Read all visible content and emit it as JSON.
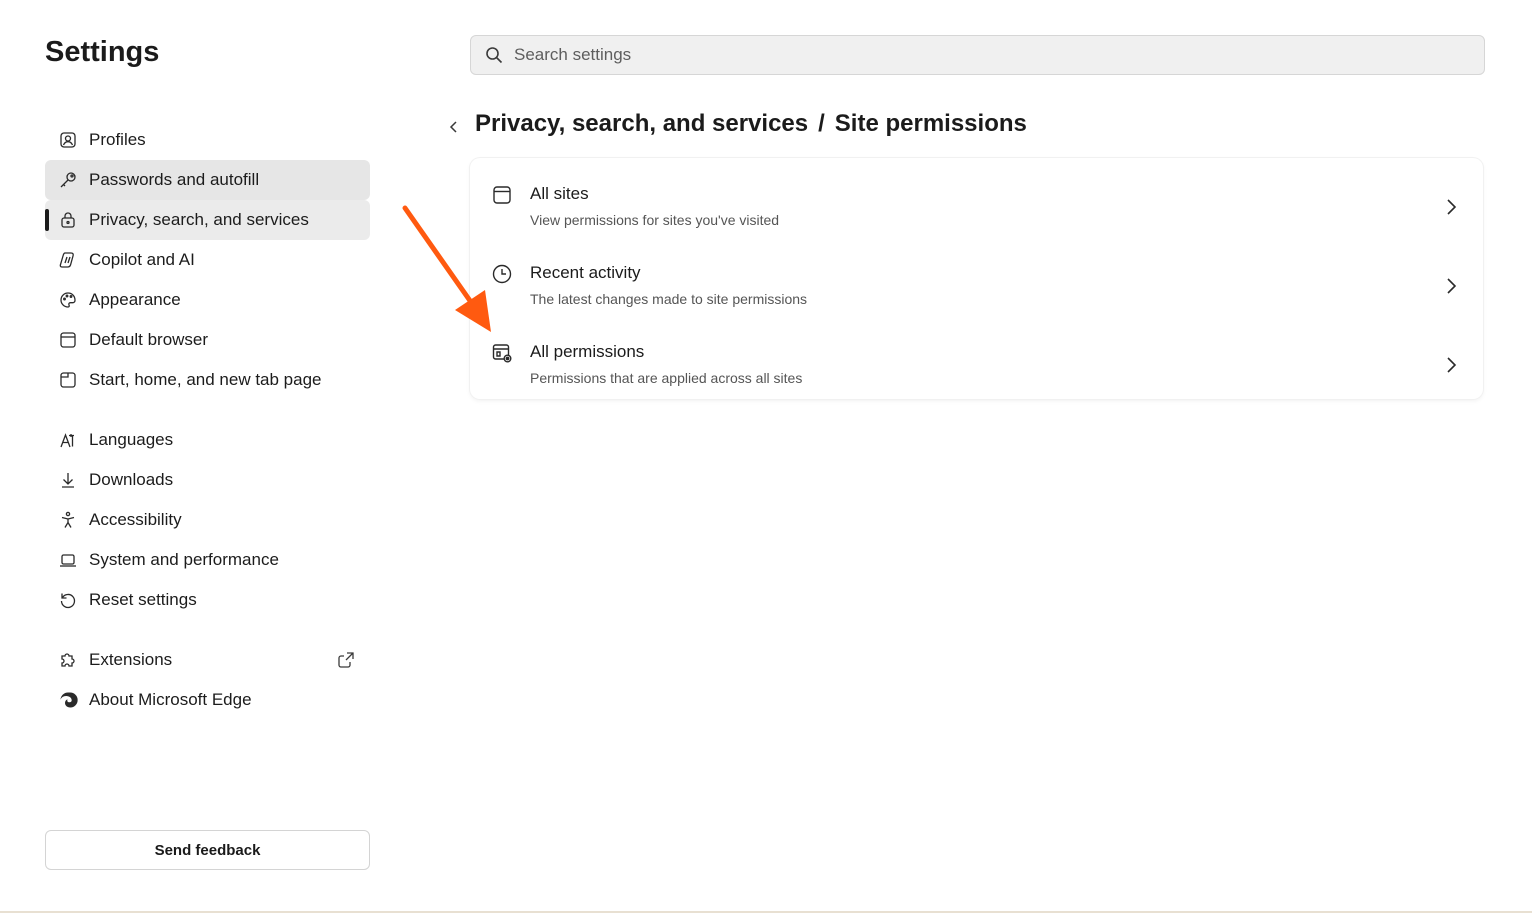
{
  "sidebar": {
    "title": "Settings",
    "items": [
      {
        "label": "Profiles",
        "icon": "profile-icon"
      },
      {
        "label": "Passwords and autofill",
        "icon": "key-icon"
      },
      {
        "label": "Privacy, search, and services",
        "icon": "lock-icon"
      },
      {
        "label": "Copilot and AI",
        "icon": "copilot-icon"
      },
      {
        "label": "Appearance",
        "icon": "palette-icon"
      },
      {
        "label": "Default browser",
        "icon": "browser-icon"
      },
      {
        "label": "Start, home, and new tab page",
        "icon": "home-tab-icon"
      },
      {
        "label": "Languages",
        "icon": "language-icon"
      },
      {
        "label": "Downloads",
        "icon": "download-icon"
      },
      {
        "label": "Accessibility",
        "icon": "accessibility-icon"
      },
      {
        "label": "System and performance",
        "icon": "laptop-icon"
      },
      {
        "label": "Reset settings",
        "icon": "reset-icon"
      },
      {
        "label": "Extensions",
        "icon": "puzzle-icon"
      },
      {
        "label": "About Microsoft Edge",
        "icon": "edge-logo-icon"
      }
    ],
    "feedback_label": "Send feedback"
  },
  "search": {
    "placeholder": "Search settings"
  },
  "breadcrumb": {
    "parent": "Privacy, search, and services",
    "separator": "/",
    "current": "Site permissions"
  },
  "rows": [
    {
      "title": "All sites",
      "description": "View permissions for sites you've visited",
      "icon": "site-window-icon"
    },
    {
      "title": "Recent activity",
      "description": "The latest changes made to site permissions",
      "icon": "clock-icon"
    },
    {
      "title": "All permissions",
      "description": "Permissions that are applied across all sites",
      "icon": "permissions-gear-icon"
    }
  ],
  "colors": {
    "annotation_arrow": "#ff5a10",
    "selected_bg": "#ebebeb",
    "hover_bg": "#e6e6e6"
  }
}
